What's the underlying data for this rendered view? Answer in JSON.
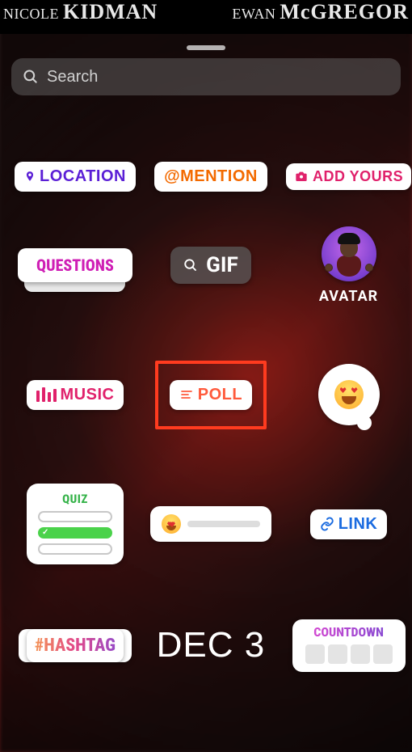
{
  "backdrop": {
    "credit_left_small": "NICOLE",
    "credit_left_big": "KIDMAN",
    "credit_right_small": "EWAN",
    "credit_right_big": "McGREGOR"
  },
  "search": {
    "placeholder": "Search"
  },
  "stickers": {
    "location": "LOCATION",
    "mention": "@MENTION",
    "add_yours": "ADD YOURS",
    "questions": "QUESTIONS",
    "gif": "GIF",
    "avatar_label": "AVATAR",
    "music": "MUSIC",
    "poll": "POLL",
    "quiz": "QUIZ",
    "link": "LINK",
    "hashtag": "#HASHTAG",
    "date": "DEC 3",
    "countdown": "COUNTDOWN"
  },
  "highlight": {
    "target": "poll"
  },
  "colors": {
    "location": "#5b1fd6",
    "mention": "#f36a00",
    "add_yours": "#e0216b",
    "questions": "#cf1fb5",
    "music": "#e0216b",
    "poll": "#ff5a3c",
    "link": "#1a6be0",
    "quiz": "#36b34a",
    "highlight_border": "#ff3b1f"
  }
}
